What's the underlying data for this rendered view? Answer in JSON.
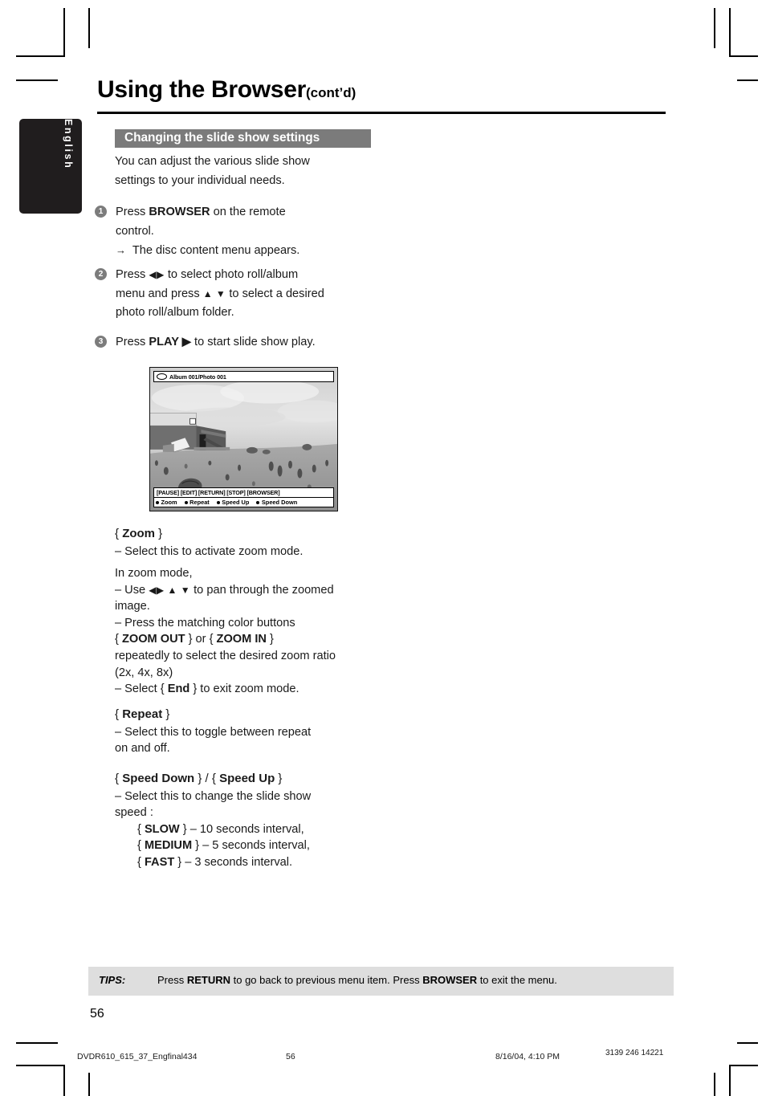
{
  "language_tab": {
    "label": "English"
  },
  "header": {
    "title": "Using the Browser",
    "contd": "(cont’d)"
  },
  "section": {
    "heading": "Changing the slide show settings",
    "intro_line1": "You can adjust the various slide show",
    "intro_line2": "settings to your individual needs."
  },
  "steps": [
    {
      "number": "1",
      "line1_a": "Press ",
      "line1_b": "BROWSER",
      "line1_c": " on the remote",
      "line2": "control.",
      "result_arrow": "→",
      "result": "The disc content menu appears."
    },
    {
      "number": "2",
      "line1_a": "Press ",
      "line1_b": "◀▶",
      "line1_c": " to select photo roll/album",
      "line2_a": "menu and press ",
      "line2_b": "▲ ▼",
      "line2_c": " to select a desired",
      "line3": "photo roll/album folder."
    },
    {
      "number": "3",
      "line1_a": "Press ",
      "line1_b": "PLAY ▶",
      "line1_c": "  to start slide show play."
    }
  ],
  "tv_screen": {
    "disc_icon": "disc-icon",
    "title": "Album 001/Photo 001",
    "keys_bar": "[PAUSE] [EDIT] [RETURN] [STOP] [BROWSER]",
    "color_buttons": [
      {
        "label": "Zoom"
      },
      {
        "label": "Repeat"
      },
      {
        "label": "Speed Up"
      },
      {
        "label": "Speed Down"
      }
    ],
    "photo_description": "black and white photograph of a weathered wooden shack in an open field under a cloudy sky"
  },
  "zoom_block": {
    "heading_open": "{ ",
    "heading_bold": "Zoom",
    "heading_close": " }",
    "line1": "–   Select this to activate zoom mode.",
    "line2": "In zoom mode,",
    "line3_a": "–   Use ",
    "line3_b": "◀▶ ▲ ▼",
    "line3_c": " to pan through the zoomed",
    "line4": "image.",
    "line5": "–   Press the matching color buttons",
    "line6_a": "{ ",
    "line6_b": "ZOOM OUT",
    "line6_c": " } or { ",
    "line6_d": "ZOOM IN",
    "line6_e": " }",
    "line7": "repeatedly to select the desired zoom ratio",
    "line8": "(2x, 4x, 8x)",
    "line9_a": "–   Select { ",
    "line9_b": "End",
    "line9_c": " } to exit zoom mode."
  },
  "repeat_block": {
    "heading_open": "{ ",
    "heading_bold": "Repeat",
    "heading_close": " }",
    "line1": "–   Select this to toggle between repeat",
    "line2": "on and off."
  },
  "speed_block": {
    "heading_open": "{ ",
    "heading_bold_a": "Speed Down",
    "heading_mid": " } / { ",
    "heading_bold_b": "Speed Up",
    "heading_close": " }",
    "line1": "–   Select this to change the slide show",
    "line2": "speed :",
    "options": [
      {
        "open": "{ ",
        "name": "SLOW",
        "close": " } – 10 seconds interval,"
      },
      {
        "open": "{ ",
        "name": "MEDIUM",
        "close": " } – 5 seconds interval,"
      },
      {
        "open": "{ ",
        "name": "FAST",
        "close": " } – 3 seconds interval."
      }
    ]
  },
  "tips": {
    "label": "TIPS:",
    "text_a": "Press ",
    "text_b": "RETURN",
    "text_c": " to go back to previous menu item.  Press ",
    "text_d": "BROWSER",
    "text_e": " to exit the menu."
  },
  "page_number": "56",
  "print_footer": {
    "file": "DVDR610_615_37_Engfinal434",
    "page": "56",
    "date": "8/16/04, 4:10 PM",
    "code": "3139 246 14221"
  },
  "colors": {
    "section_bar": "#7b7b7b",
    "tab_background": "#201d1e",
    "tips_background": "#dedede",
    "step_bullet": "#7c7c7c"
  }
}
